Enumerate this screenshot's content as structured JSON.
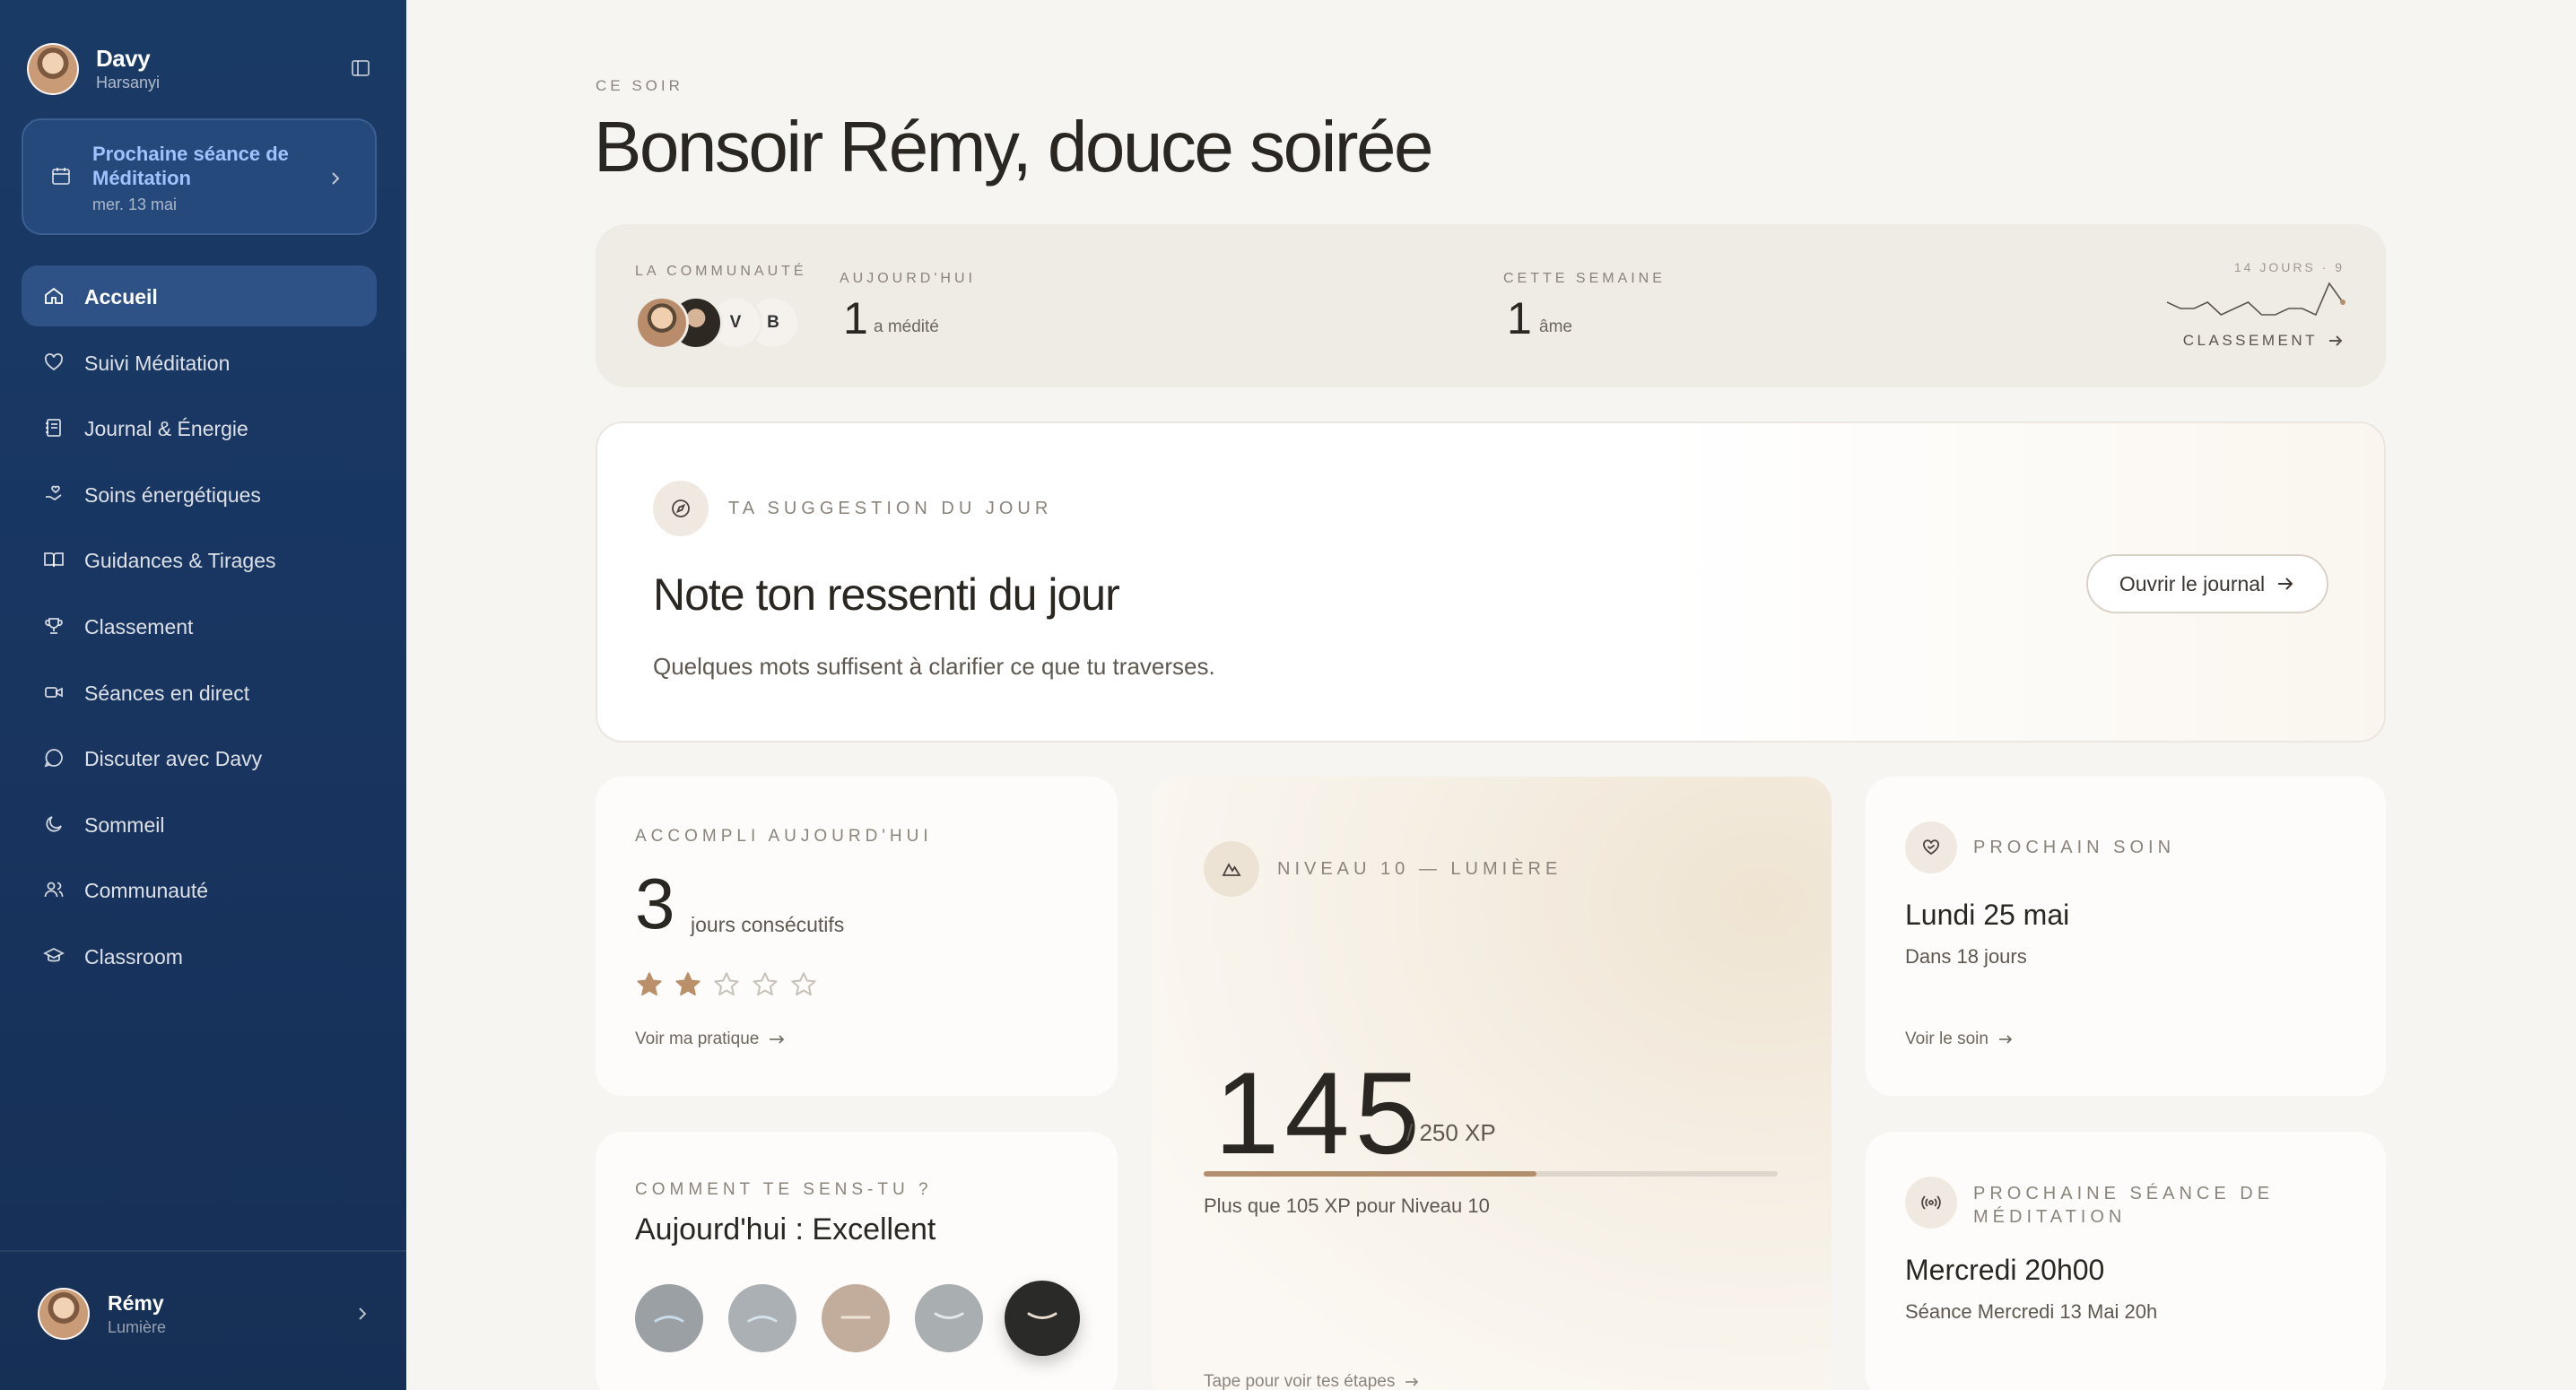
{
  "sidebar": {
    "profile": {
      "name": "Davy",
      "subtitle": "Harsanyi"
    },
    "next_session": {
      "title": "Prochaine séance de Méditation",
      "date": "mer. 13 mai"
    },
    "items": [
      {
        "label": "Accueil",
        "icon": "home-icon",
        "active": true
      },
      {
        "label": "Suivi Méditation",
        "icon": "heart-icon"
      },
      {
        "label": "Journal & Énergie",
        "icon": "notebook-icon"
      },
      {
        "label": "Soins énergétiques",
        "icon": "hand-heart-icon"
      },
      {
        "label": "Guidances & Tirages",
        "icon": "book-icon"
      },
      {
        "label": "Classement",
        "icon": "trophy-icon"
      },
      {
        "label": "Séances en direct",
        "icon": "video-icon"
      },
      {
        "label": "Discuter avec Davy",
        "icon": "chat-icon"
      },
      {
        "label": "Sommeil",
        "icon": "moon-icon"
      },
      {
        "label": "Communauté",
        "icon": "users-icon"
      },
      {
        "label": "Classroom",
        "icon": "graduation-cap-icon"
      }
    ],
    "user": {
      "name": "Rémy",
      "level": "Lumière"
    }
  },
  "header": {
    "kicker": "CE SOIR",
    "title": "Bonsoir Rémy, douce soirée"
  },
  "community": {
    "label": "LA COMMUNAUTÉ",
    "avatar_letters": [
      "V",
      "B"
    ],
    "today": {
      "label": "AUJOURD'HUI",
      "value": "1",
      "unit": "a médité"
    },
    "week": {
      "label": "CETTE SEMAINE",
      "value": "1",
      "unit": "âme"
    },
    "spark_label": "14 JOURS · 9",
    "spark_values": [
      3,
      2,
      2,
      3,
      1,
      2,
      3,
      1,
      1,
      2,
      2,
      1,
      6,
      3
    ],
    "ranking_link": "CLASSEMENT"
  },
  "suggestion": {
    "eyebrow": "TA SUGGESTION DU JOUR",
    "title": "Note ton ressenti du jour",
    "description": "Quelques mots suffisent à clarifier ce que tu traverses.",
    "button": "Ouvrir le journal"
  },
  "accomplished": {
    "eyebrow": "ACCOMPLI AUJOURD'HUI",
    "value": "3",
    "unit": "jours consécutifs",
    "stars_filled": 2,
    "stars_total": 5,
    "link": "Voir ma pratique"
  },
  "level": {
    "eyebrow": "NIVEAU 10 — LUMIÈRE",
    "xp": "145",
    "xp_max": "/ 250 XP",
    "progress": 0.58,
    "remaining": "Plus que 105 XP pour Niveau 10",
    "tap": "Tape pour voir tes étapes"
  },
  "feeling": {
    "eyebrow": "COMMENT TE SENS-TU ?",
    "title": "Aujourd'hui : Excellent",
    "selected_index": 4,
    "moods": [
      {
        "color": "#9aa0a3",
        "mouth": "#c9dbe8",
        "shape": "frown"
      },
      {
        "color": "#aab0b3",
        "mouth": "#d5e2ea",
        "shape": "frown"
      },
      {
        "color": "#c2ad9c",
        "mouth": "#efe3d8",
        "shape": "flat"
      },
      {
        "color": "#a9aeb0",
        "mouth": "#e3e8ea",
        "shape": "smile"
      },
      {
        "color": "#2a2b28",
        "mouth": "#e8ddd0",
        "shape": "smile"
      }
    ]
  },
  "next_care": {
    "eyebrow": "PROCHAIN SOIN",
    "title": "Lundi 25 mai",
    "subtitle": "Dans 18 jours",
    "link": "Voir le soin"
  },
  "next_meditation": {
    "eyebrow": "PROCHAINE SÉANCE DE MÉDITATION",
    "title": "Mercredi 20h00",
    "subtitle": "Séance Mercredi 13 Mai 20h"
  }
}
